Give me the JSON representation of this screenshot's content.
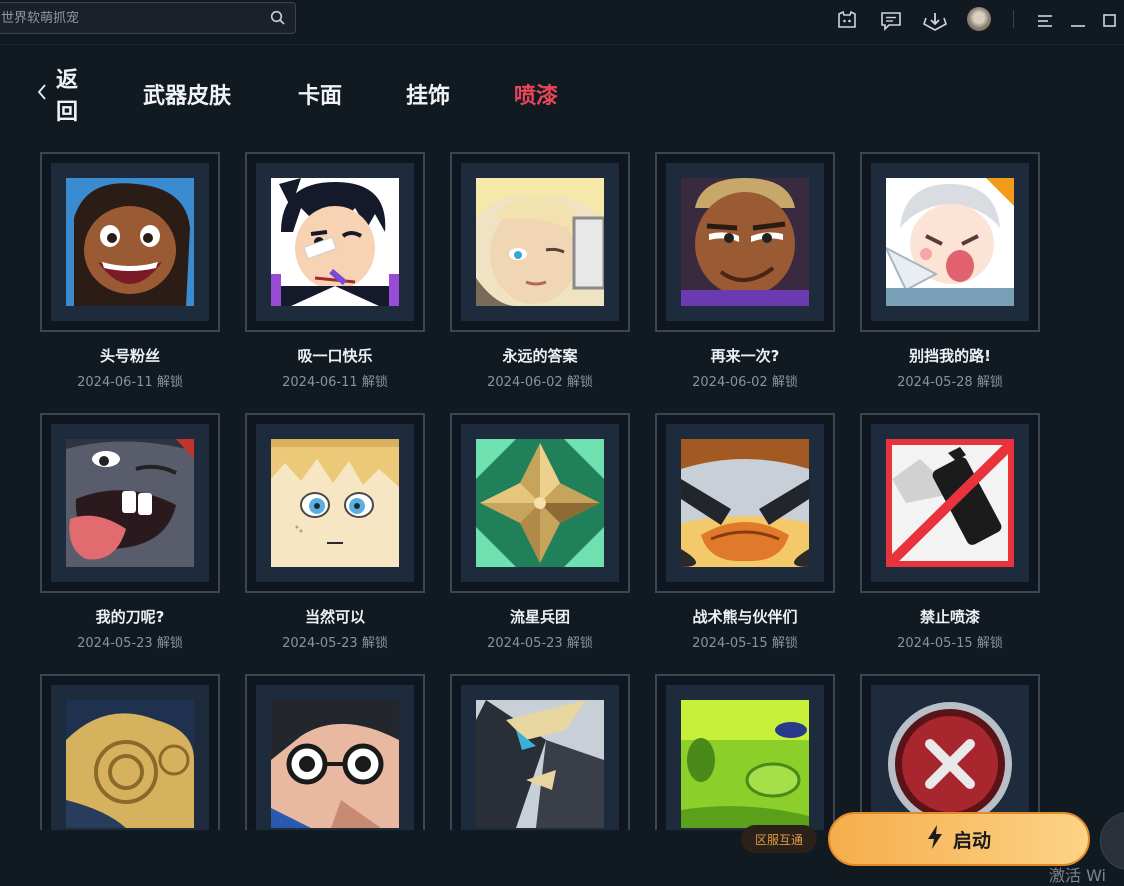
{
  "search": {
    "placeholder": "世界软萌抓宠"
  },
  "header_icons": [
    "chat-bot-icon",
    "message-icon",
    "download-icon",
    "avatar",
    "menu-icon",
    "minimize-icon",
    "restore-icon"
  ],
  "nav": {
    "back_label": "返回",
    "tabs": [
      "武器皮肤",
      "卡面",
      "挂饰",
      "喷漆"
    ],
    "active_tab": "喷漆"
  },
  "colors": {
    "background": "#111921",
    "active_tab": "#e9465a",
    "launch_button": "#f8b85a",
    "badge_text": "#e39a46"
  },
  "sprays": [
    {
      "name": "头号粉丝",
      "date": "2024-06-11",
      "unlock": "解锁"
    },
    {
      "name": "吸一口快乐",
      "date": "2024-06-11",
      "unlock": "解锁"
    },
    {
      "name": "永远的答案",
      "date": "2024-06-02",
      "unlock": "解锁"
    },
    {
      "name": "再来一次?",
      "date": "2024-06-02",
      "unlock": "解锁"
    },
    {
      "name": "别挡我的路!",
      "date": "2024-05-28",
      "unlock": "解锁"
    },
    {
      "name": "我的刀呢?",
      "date": "2024-05-23",
      "unlock": "解锁"
    },
    {
      "name": "当然可以",
      "date": "2024-05-23",
      "unlock": "解锁"
    },
    {
      "name": "流星兵团",
      "date": "2024-05-23",
      "unlock": "解锁"
    },
    {
      "name": "战术熊与伙伴们",
      "date": "2024-05-15",
      "unlock": "解锁"
    },
    {
      "name": "禁止喷漆",
      "date": "2024-05-15",
      "unlock": "解锁"
    },
    {
      "name": "",
      "date": "",
      "unlock": ""
    },
    {
      "name": "",
      "date": "",
      "unlock": ""
    },
    {
      "name": "",
      "date": "",
      "unlock": ""
    },
    {
      "name": "",
      "date": "",
      "unlock": ""
    },
    {
      "name": "",
      "date": "",
      "unlock": ""
    }
  ],
  "bottom": {
    "region_badge": "区服互通",
    "launch_label": "启动",
    "watermark": "激活 Wi"
  }
}
